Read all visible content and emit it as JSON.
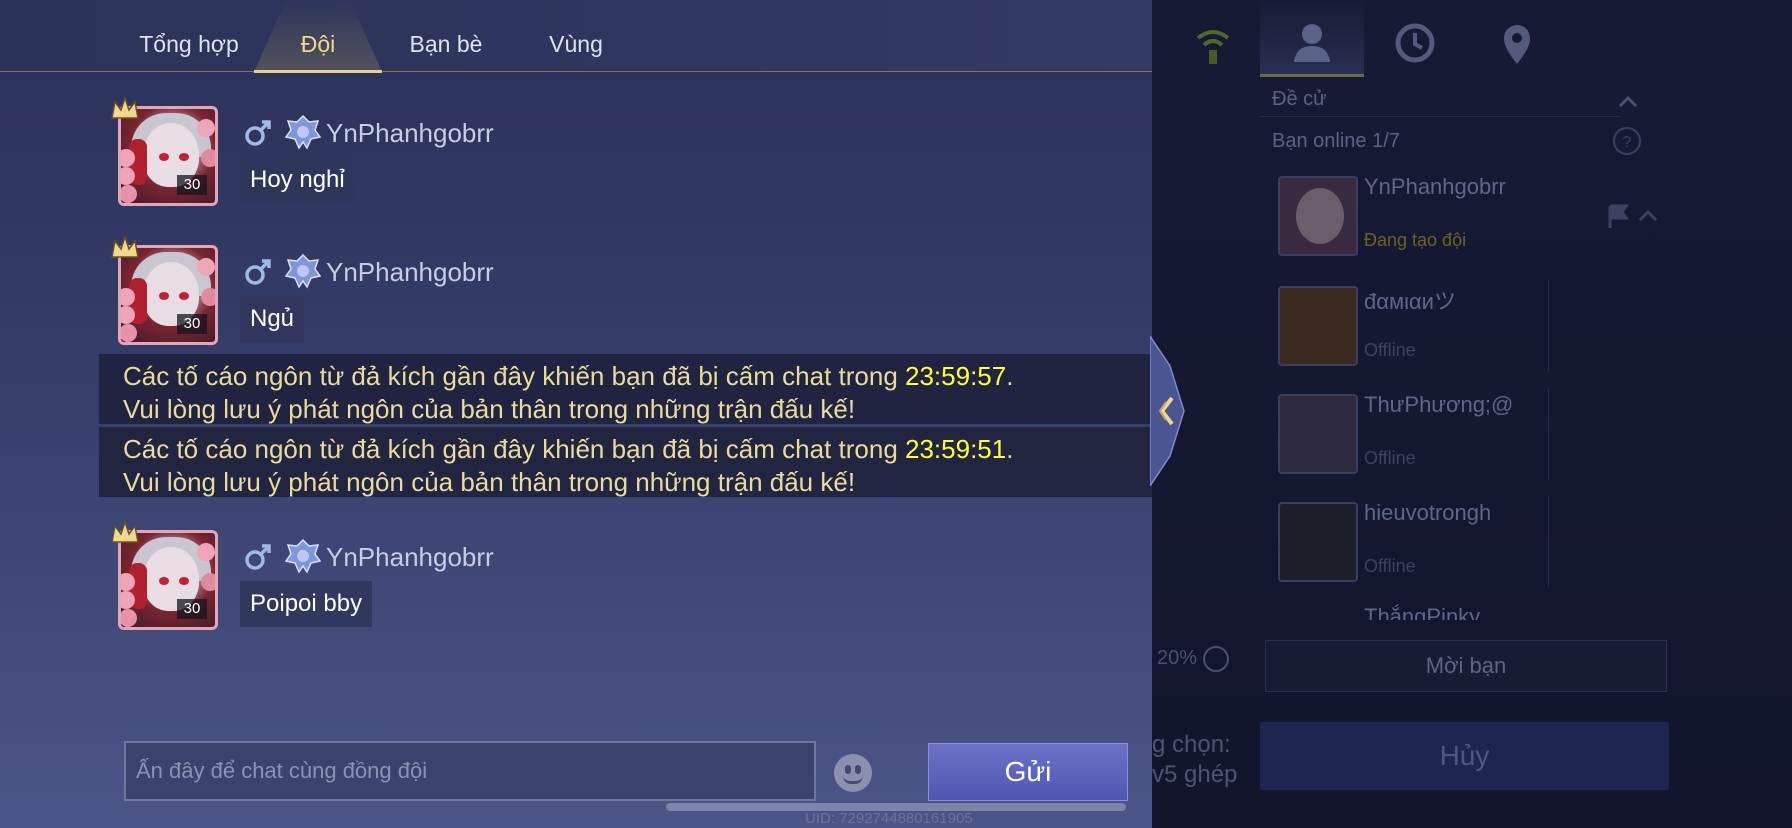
{
  "tabs": [
    {
      "label": "Tổng hợp",
      "active": false
    },
    {
      "label": "Đội",
      "active": true
    },
    {
      "label": "Bạn bè",
      "active": false
    },
    {
      "label": "Vùng",
      "active": false
    }
  ],
  "messages": [
    {
      "sender": "YnPhanhgobrr",
      "level": "30",
      "text": "Hoy nghỉ"
    },
    {
      "sender": "YnPhanhgobrr",
      "level": "30",
      "text": "Ngủ"
    },
    {
      "sender": "YnPhanhgobrr",
      "level": "30",
      "text": "Poipoi bby"
    }
  ],
  "system_messages": [
    {
      "line1_prefix": "Các tố cáo ngôn từ đả kích gần đây khiến bạn đã bị cấm chat trong ",
      "time": "23:59:57",
      "line1_suffix": ".",
      "line2": "Vui lòng lưu ý phát ngôn của bản thân trong những trận đấu kế!"
    },
    {
      "line1_prefix": "Các tố cáo ngôn từ đả kích gần đây khiến bạn đã bị cấm chat trong ",
      "time": "23:59:51",
      "line1_suffix": ".",
      "line2": "Vui lòng lưu ý phát ngôn của bản thân trong những trận đấu kế!"
    }
  ],
  "input": {
    "placeholder": "Ấn đây để chat cùng đồng đội"
  },
  "send_label": "Gửi",
  "uid": "UID: 7292744880161905",
  "right_panel": {
    "recommend_label": "Đề cử",
    "online_label": "Bạn online 1/7",
    "friends": [
      {
        "name": "YnPhanhgobrr",
        "status": "Đang tạo đội"
      },
      {
        "name": "đαмιαиツ",
        "status": "Offline"
      },
      {
        "name": "ThưPhương;@",
        "status": "Offline"
      },
      {
        "name": "hieuvotrongh",
        "status": "Offline"
      },
      {
        "name": "ThắngPinky",
        "status": ""
      }
    ],
    "invite_label": "Mời bạn",
    "bonus_percent": "20%",
    "mode_line1": "g chọn:",
    "mode_line2": "v5 ghép",
    "cancel_label": "Hủy"
  },
  "colors": {
    "panel_bg": "#353d6a",
    "active_tab": "#f2d98d",
    "system_highlight": "#ffff3a",
    "system_text": "#eadb9d",
    "send_button": "#5a60bd"
  }
}
